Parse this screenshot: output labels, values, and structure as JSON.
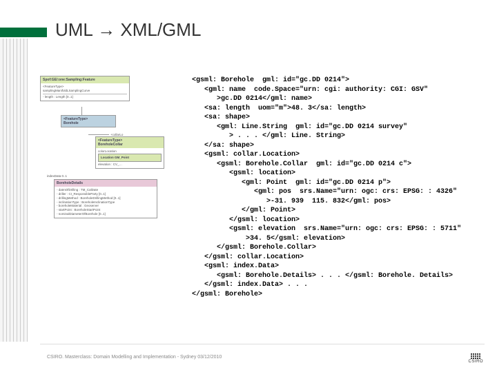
{
  "title": "UML → XML/GML",
  "diagram": {
    "box1_hdr": "Spof:GE/:one:Sampling:Feature",
    "box1_l1": "<FeatureType>",
    "box1_l2": "samplingManifoldLSamplingCurve",
    "box1_l3": "- length : Length [0..1]",
    "box2_hdr": "<FeatureType>",
    "box2_sub": "Borehole",
    "collar_label": "+collarLo",
    "box3_hdr": "<FeatureType>",
    "box3_sub": "BoreholeCollar",
    "box3_l1": "colorLocation",
    "box3_l2": "Location   GM_Point",
    "box3_l3": "elevation : CV_…",
    "indexd": "indexData    0..1",
    "box4_hdr": "BoreholeDetails",
    "box4_l1": "- datmOfDrilling : TM_CalDate",
    "box4_l2": "- driller : CI_ResponsibleParty [0..1]",
    "box4_l3": "- drillingMethod : BoreholeDrillingMethod [0..1]",
    "box4_l4": "- inclinationType : BoreholeInclinationType",
    "box4_l5": "- boreholeMaterial : Geoserver",
    "box4_l6": "- startPoint : BoreholeStartPoint",
    "box4_l7": "- nominalDiameterOfBorehole [0..1]"
  },
  "code": {
    "l01": "<gsml: Borehole  gml: id=\"gc.DD 0214\">",
    "l02": "   <gml: name  code.Space=\"urn: cgi: authority: CGI: GSV\"",
    "l03": "      >gc.DD 0214</gml: name>",
    "l04": "   <sa: length  uom=\"m\">48. 3</sa: length>",
    "l05": "   <sa: shape>",
    "l06": "      <gml: Line.String  gml: id=\"gc.DD 0214 survey\"",
    "l07": "         > . . . </gml: Line. String>",
    "l08": "   </sa: shape>",
    "l09": "   <gsml: collar.Location>",
    "l10": "      <gsml: Borehole.Collar  gml: id=\"gc.DD 0214 c\">",
    "l11": "         <gsml: location>",
    "l12": "            <gml: Point  gml: id=\"gc.DD 0214 p\">",
    "l13": "               <gml: pos  srs.Name=\"urn: ogc: crs: EPSG: : 4326\"",
    "l14": "                  >-31. 939  115. 832</gml: pos>",
    "l15": "            </gml: Point>",
    "l16": "         </gsml: location>",
    "l17": "         <gsml: elevation  srs.Name=\"urn: ogc: crs: EPSG: : 5711\"",
    "l18": "             >34. 5</gsml: elevation>",
    "l19": "      </gsml: Borehole.Collar>",
    "l20": "   </gsml: collar.Location>",
    "l21": "   <gsml: index.Data>",
    "l22": "      <gsml: Borehole.Details> . . . </gsml: Borehole. Details>",
    "l23": "   </gsml: index.Data> . . .",
    "l24": "</gsml: Borehole>"
  },
  "footer": "CSIRO.  Masterclass: Domain Modelling and Implementation - Sydney 03/12/2010",
  "logo_text": "CSIRO"
}
